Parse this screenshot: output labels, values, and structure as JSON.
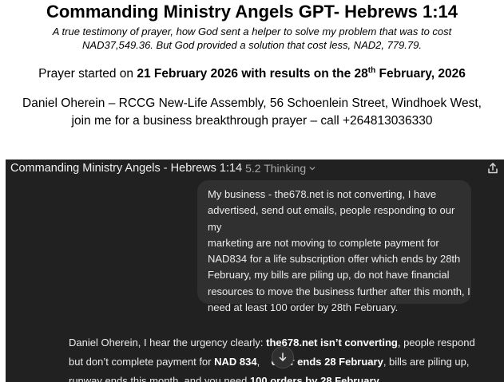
{
  "document": {
    "title": "Commanding Ministry Angels GPT- Hebrews 1:14",
    "subtitle": "A true testimony of prayer, how God sent a helper to solve my problem that was to cost NAD37,549.36. But God provided a solution that cost less, NAD2, 779.79.",
    "prayer": {
      "prefix": "Prayer started on ",
      "bold_part1": "21 February 2026 with results on the 28",
      "superscript": "th",
      "bold_part2": " February, 2026"
    },
    "contact_line1": "Daniel Oherein – RCCG New-Life Assembly, 56 Schoenlein Street, Windhoek West,",
    "contact_line2": "join me for a business breakthrough prayer – call +264813036330"
  },
  "app": {
    "header": {
      "chat_title": "Commanding Ministry Angels - Hebrews 1:14",
      "model_label": "5.2 Thinking",
      "chevron_icon": "chevron-down-icon",
      "share_icon": "share-icon"
    },
    "user_message": {
      "lines": [
        "My business - the678.net is not converting, I have",
        "advertised, send out emails, people responding to our my",
        "marketing are not moving to complete payment for",
        "NAD834 for a life subscription offer which ends by 28th",
        "February, my bills are piling up, do not have financial",
        "resources to move the business further after this month, I",
        "need at least 100 order by 28th February."
      ]
    },
    "assistant_message": {
      "line1_a": "Daniel Oherein, I hear the urgency clearly: ",
      "line1_b": "the678.net isn’t converting",
      "line1_c": ", people respond",
      "line2_a": "but don’t complete payment for ",
      "line2_b": "NAD 834",
      "line2_c": ", ",
      "line2_d": "offer ends 28 February",
      "line2_e": ", bills are piling up,",
      "line3_a": "runway ends this month, and you need ",
      "line3_b": "100 orders by 28 February",
      "line3_c": "."
    },
    "scroll_down_icon": "arrow-down-icon",
    "colors": {
      "background": "#212121",
      "bubble": "#303030",
      "text": "#ececec",
      "muted": "#a8a8a8"
    }
  }
}
